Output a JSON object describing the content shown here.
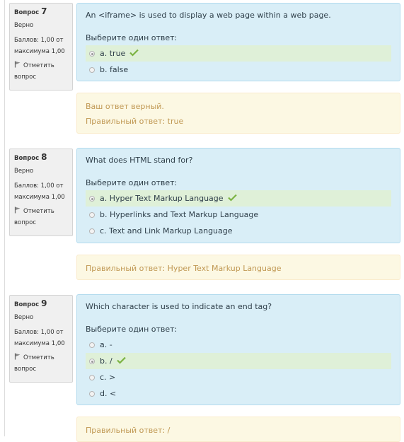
{
  "questions": [
    {
      "label": "Вопрос",
      "number": "7",
      "state": "Верно",
      "grade": "Баллов: 1,00 от максимума 1,00",
      "flag_label": "Отметить вопрос",
      "text": "An <iframe> is used to display a web page within a web page.",
      "prompt": "Выберите один ответ:",
      "answers": [
        {
          "text": "a. true",
          "checked": true,
          "correct": true
        },
        {
          "text": "b. false",
          "checked": false,
          "correct": false
        }
      ],
      "feedback": "Ваш ответ верный.",
      "right_answer": "Правильный ответ: true"
    },
    {
      "label": "Вопрос",
      "number": "8",
      "state": "Верно",
      "grade": "Баллов: 1,00 от максимума 1,00",
      "flag_label": "Отметить вопрос",
      "text": "What does HTML stand for?",
      "prompt": "Выберите один ответ:",
      "answers": [
        {
          "text": "a. Hyper Text Markup Language",
          "checked": true,
          "correct": true
        },
        {
          "text": "b. Hyperlinks and Text Markup Language",
          "checked": false,
          "correct": false
        },
        {
          "text": "c. Text and Link Markup Language",
          "checked": false,
          "correct": false
        }
      ],
      "right_answer": "Правильный ответ: Hyper Text Markup Language"
    },
    {
      "label": "Вопрос",
      "number": "9",
      "state": "Верно",
      "grade": "Баллов: 1,00 от максимума 1,00",
      "flag_label": "Отметить вопрос",
      "text": "Which character is used to indicate an end tag?",
      "prompt": "Выберите один ответ:",
      "answers": [
        {
          "text": "a. -",
          "checked": false,
          "correct": false
        },
        {
          "text": "b. /",
          "checked": true,
          "correct": true
        },
        {
          "text": "c. >",
          "checked": false,
          "correct": false
        },
        {
          "text": "d. <",
          "checked": false,
          "correct": false
        }
      ],
      "right_answer": "Правильный ответ: /"
    }
  ],
  "colors": {
    "info_bg": "#f0f0f0",
    "content_bg": "#d9eef7",
    "correct_bg": "#dff0d8",
    "outcome_bg": "#fcf8e3",
    "outcome_text": "#c09853",
    "tick": "#7cb342"
  }
}
